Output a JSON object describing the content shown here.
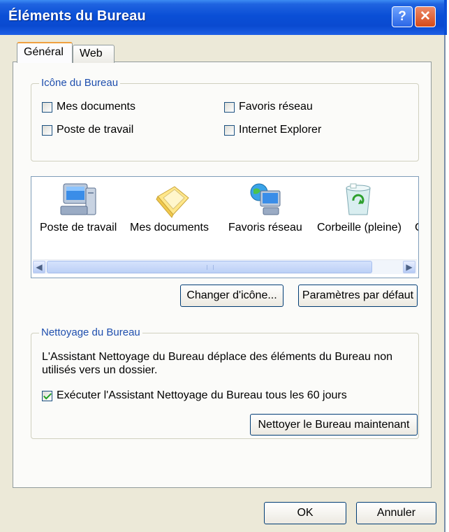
{
  "window": {
    "title": "Éléments du Bureau"
  },
  "tabs": [
    {
      "label": "Général"
    },
    {
      "label": "Web"
    }
  ],
  "desktop_icons": {
    "legend": "Icône du Bureau",
    "items": [
      {
        "label": "Mes documents",
        "checked": false
      },
      {
        "label": "Favoris réseau",
        "checked": false
      },
      {
        "label": "Poste de travail",
        "checked": false
      },
      {
        "label": "Internet Explorer",
        "checked": false
      }
    ]
  },
  "icon_list": {
    "items": [
      {
        "label": "Poste de travail",
        "icon": "computer-icon"
      },
      {
        "label": "Mes documents",
        "icon": "folder-icon"
      },
      {
        "label": "Favoris réseau",
        "icon": "network-places-icon"
      },
      {
        "label": "Corbeille (pleine)",
        "icon": "recycle-bin-full-icon"
      },
      {
        "label": "C",
        "icon": "truncated-icon"
      }
    ]
  },
  "buttons": {
    "change_icon": "Changer d'icône...",
    "restore_default": "Paramètres par défaut",
    "clean_desktop": "Nettoyer le Bureau maintenant",
    "ok": "OK",
    "cancel": "Annuler"
  },
  "cleanup": {
    "legend": "Nettoyage du Bureau",
    "description_line1": "L'Assistant Nettoyage du Bureau déplace des éléments du Bureau non",
    "description_line2": "utilisés vers un dossier.",
    "checkbox_label": "Exécuter l'Assistant Nettoyage du Bureau tous les 60 jours",
    "checkbox_checked": true
  },
  "colors": {
    "titlebar": "#0a4fd6",
    "dialog_bg": "#ece9d8",
    "group_legend": "#1f4fae",
    "tab_highlight": "#f0a040"
  }
}
